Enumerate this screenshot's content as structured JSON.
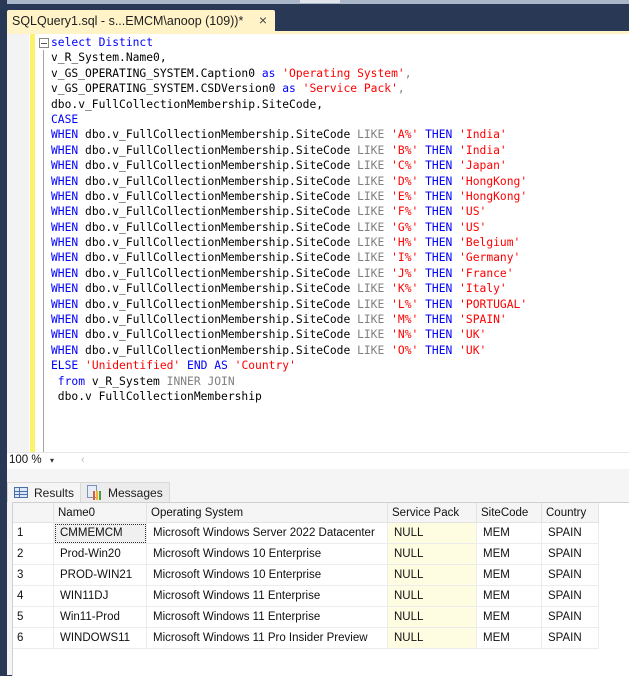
{
  "tab": {
    "title": "SQLQuery1.sql - s...EMCM\\anoop (109))*",
    "close_icon": "×"
  },
  "editor": {
    "lines": [
      [
        {
          "t": "select Distinct",
          "c": "kw"
        }
      ],
      [
        {
          "t": "v_R_System.Name0,",
          "c": "fn"
        }
      ],
      [
        {
          "t": "v_GS_OPERATING_SYSTEM.Caption0 ",
          "c": "fn"
        },
        {
          "t": "as ",
          "c": "kw"
        },
        {
          "t": "'Operating System'",
          "c": "str"
        },
        {
          "t": ",",
          "c": "op"
        }
      ],
      [
        {
          "t": "v_GS_OPERATING_SYSTEM.CSDVersion0 ",
          "c": "fn"
        },
        {
          "t": "as ",
          "c": "kw"
        },
        {
          "t": "'Service Pack'",
          "c": "str"
        },
        {
          "t": ",",
          "c": "op"
        }
      ],
      [
        {
          "t": "dbo.v_FullCollectionMembership.SiteCode,",
          "c": "fn"
        }
      ],
      [
        {
          "t": "CASE",
          "c": "kw"
        }
      ],
      [
        {
          "t": "WHEN ",
          "c": "kw"
        },
        {
          "t": "dbo.v_FullCollectionMembership.SiteCode ",
          "c": "fn"
        },
        {
          "t": "LIKE ",
          "c": "op"
        },
        {
          "t": "'A%' ",
          "c": "str"
        },
        {
          "t": "THEN ",
          "c": "kw"
        },
        {
          "t": "'India'",
          "c": "str"
        }
      ],
      [
        {
          "t": "WHEN ",
          "c": "kw"
        },
        {
          "t": "dbo.v_FullCollectionMembership.SiteCode ",
          "c": "fn"
        },
        {
          "t": "LIKE ",
          "c": "op"
        },
        {
          "t": "'B%' ",
          "c": "str"
        },
        {
          "t": "THEN ",
          "c": "kw"
        },
        {
          "t": "'India'",
          "c": "str"
        }
      ],
      [
        {
          "t": "WHEN ",
          "c": "kw"
        },
        {
          "t": "dbo.v_FullCollectionMembership.SiteCode ",
          "c": "fn"
        },
        {
          "t": "LIKE ",
          "c": "op"
        },
        {
          "t": "'C%' ",
          "c": "str"
        },
        {
          "t": "THEN ",
          "c": "kw"
        },
        {
          "t": "'Japan'",
          "c": "str"
        }
      ],
      [
        {
          "t": "WHEN ",
          "c": "kw"
        },
        {
          "t": "dbo.v_FullCollectionMembership.SiteCode ",
          "c": "fn"
        },
        {
          "t": "LIKE ",
          "c": "op"
        },
        {
          "t": "'D%' ",
          "c": "str"
        },
        {
          "t": "THEN ",
          "c": "kw"
        },
        {
          "t": "'HongKong'",
          "c": "str"
        }
      ],
      [
        {
          "t": "WHEN ",
          "c": "kw"
        },
        {
          "t": "dbo.v_FullCollectionMembership.SiteCode ",
          "c": "fn"
        },
        {
          "t": "LIKE ",
          "c": "op"
        },
        {
          "t": "'E%' ",
          "c": "str"
        },
        {
          "t": "THEN ",
          "c": "kw"
        },
        {
          "t": "'HongKong'",
          "c": "str"
        }
      ],
      [
        {
          "t": "WHEN ",
          "c": "kw"
        },
        {
          "t": "dbo.v_FullCollectionMembership.SiteCode ",
          "c": "fn"
        },
        {
          "t": "LIKE ",
          "c": "op"
        },
        {
          "t": "'F%' ",
          "c": "str"
        },
        {
          "t": "THEN ",
          "c": "kw"
        },
        {
          "t": "'US'",
          "c": "str"
        }
      ],
      [
        {
          "t": "WHEN ",
          "c": "kw"
        },
        {
          "t": "dbo.v_FullCollectionMembership.SiteCode ",
          "c": "fn"
        },
        {
          "t": "LIKE ",
          "c": "op"
        },
        {
          "t": "'G%' ",
          "c": "str"
        },
        {
          "t": "THEN ",
          "c": "kw"
        },
        {
          "t": "'US'",
          "c": "str"
        }
      ],
      [
        {
          "t": "WHEN ",
          "c": "kw"
        },
        {
          "t": "dbo.v_FullCollectionMembership.SiteCode ",
          "c": "fn"
        },
        {
          "t": "LIKE ",
          "c": "op"
        },
        {
          "t": "'H%' ",
          "c": "str"
        },
        {
          "t": "THEN ",
          "c": "kw"
        },
        {
          "t": "'Belgium'",
          "c": "str"
        }
      ],
      [
        {
          "t": "WHEN ",
          "c": "kw"
        },
        {
          "t": "dbo.v_FullCollectionMembership.SiteCode ",
          "c": "fn"
        },
        {
          "t": "LIKE ",
          "c": "op"
        },
        {
          "t": "'I%' ",
          "c": "str"
        },
        {
          "t": "THEN ",
          "c": "kw"
        },
        {
          "t": "'Germany'",
          "c": "str"
        }
      ],
      [
        {
          "t": "WHEN ",
          "c": "kw"
        },
        {
          "t": "dbo.v_FullCollectionMembership.SiteCode ",
          "c": "fn"
        },
        {
          "t": "LIKE ",
          "c": "op"
        },
        {
          "t": "'J%' ",
          "c": "str"
        },
        {
          "t": "THEN ",
          "c": "kw"
        },
        {
          "t": "'France'",
          "c": "str"
        }
      ],
      [
        {
          "t": "WHEN ",
          "c": "kw"
        },
        {
          "t": "dbo.v_FullCollectionMembership.SiteCode ",
          "c": "fn"
        },
        {
          "t": "LIKE ",
          "c": "op"
        },
        {
          "t": "'K%' ",
          "c": "str"
        },
        {
          "t": "THEN ",
          "c": "kw"
        },
        {
          "t": "'Italy'",
          "c": "str"
        }
      ],
      [
        {
          "t": "WHEN ",
          "c": "kw"
        },
        {
          "t": "dbo.v_FullCollectionMembership.SiteCode ",
          "c": "fn"
        },
        {
          "t": "LIKE ",
          "c": "op"
        },
        {
          "t": "'L%' ",
          "c": "str"
        },
        {
          "t": "THEN ",
          "c": "kw"
        },
        {
          "t": "'PORTUGAL'",
          "c": "str"
        }
      ],
      [
        {
          "t": "WHEN ",
          "c": "kw"
        },
        {
          "t": "dbo.v_FullCollectionMembership.SiteCode ",
          "c": "fn"
        },
        {
          "t": "LIKE ",
          "c": "op"
        },
        {
          "t": "'M%' ",
          "c": "str"
        },
        {
          "t": "THEN ",
          "c": "kw"
        },
        {
          "t": "'SPAIN'",
          "c": "str"
        }
      ],
      [
        {
          "t": "WHEN ",
          "c": "kw"
        },
        {
          "t": "dbo.v_FullCollectionMembership.SiteCode ",
          "c": "fn"
        },
        {
          "t": "LIKE ",
          "c": "op"
        },
        {
          "t": "'N%' ",
          "c": "str"
        },
        {
          "t": "THEN ",
          "c": "kw"
        },
        {
          "t": "'UK'",
          "c": "str"
        }
      ],
      [
        {
          "t": "WHEN ",
          "c": "kw"
        },
        {
          "t": "dbo.v_FullCollectionMembership.SiteCode ",
          "c": "fn"
        },
        {
          "t": "LIKE ",
          "c": "op"
        },
        {
          "t": "'O%' ",
          "c": "str"
        },
        {
          "t": "THEN ",
          "c": "kw"
        },
        {
          "t": "'UK'",
          "c": "str"
        }
      ],
      [
        {
          "t": "ELSE ",
          "c": "kw"
        },
        {
          "t": "'Unidentified' ",
          "c": "str"
        },
        {
          "t": "END AS ",
          "c": "kw"
        },
        {
          "t": "'Country'",
          "c": "str"
        }
      ],
      [
        {
          "t": " from ",
          "c": "kw"
        },
        {
          "t": "v_R_System ",
          "c": "fn"
        },
        {
          "t": "INNER JOIN",
          "c": "op"
        }
      ],
      [
        {
          "t": " dbo.v FullCollectionMembership",
          "c": "fn"
        }
      ]
    ]
  },
  "zoom": {
    "value": "100 %",
    "dropdown_icon": "▾",
    "scroll_left_icon": "‹"
  },
  "results": {
    "tabs": [
      {
        "label": "Results",
        "icon": "grid-icon",
        "active": true
      },
      {
        "label": "Messages",
        "icon": "messages-icon",
        "active": false
      }
    ],
    "columns": [
      "",
      "Name0",
      "Operating System",
      "Service Pack",
      "SiteCode",
      "Country"
    ],
    "rows": [
      [
        "1",
        "CMMEMCM",
        "Microsoft Windows Server 2022 Datacenter",
        "NULL",
        "MEM",
        "SPAIN"
      ],
      [
        "2",
        "Prod-Win20",
        "Microsoft Windows 10 Enterprise",
        "NULL",
        "MEM",
        "SPAIN"
      ],
      [
        "3",
        "PROD-WIN21",
        "Microsoft Windows 10 Enterprise",
        "NULL",
        "MEM",
        "SPAIN"
      ],
      [
        "4",
        "WIN11DJ",
        "Microsoft Windows 11 Enterprise",
        "NULL",
        "MEM",
        "SPAIN"
      ],
      [
        "5",
        "Win11-Prod",
        "Microsoft Windows 11 Enterprise",
        "NULL",
        "MEM",
        "SPAIN"
      ],
      [
        "6",
        "WINDOWS11",
        "Microsoft Windows 11 Pro Insider Preview",
        "NULL",
        "MEM",
        "SPAIN"
      ]
    ]
  },
  "colors": {
    "keyword": "#0000ff",
    "string": "#ff0000",
    "operator": "#808080",
    "tab_active": "#fff3c7",
    "frame": "#293955",
    "null_cell": "#fffde1",
    "change_bar": "#fdf36a"
  }
}
